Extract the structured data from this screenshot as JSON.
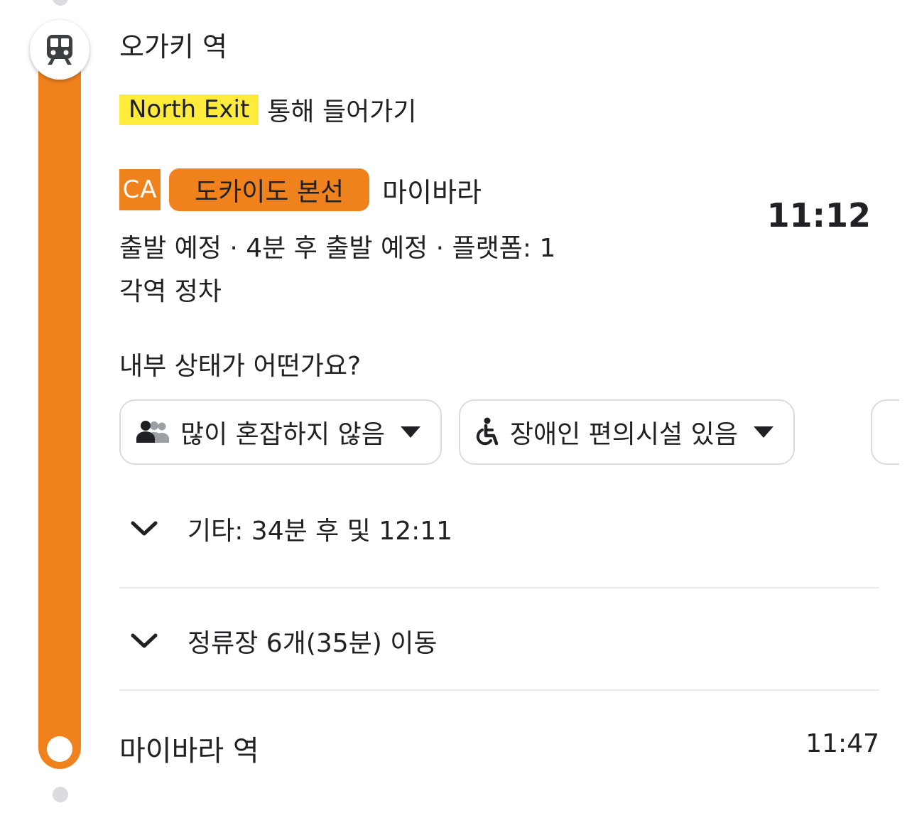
{
  "departure": {
    "station": "오가키 역",
    "exit_tag": "North Exit",
    "exit_suffix": "통해 들어가기"
  },
  "line": {
    "code": "CA",
    "name": "도카이도 본선",
    "destination": "마이바라",
    "color": "#f0821e",
    "departure_time": "11:12",
    "status": "출발 예정 · 4분 후 출발 예정 · 플랫폼: 1",
    "service": "각역 정차"
  },
  "feedback": {
    "question": "내부 상태가 어떤가요?",
    "chips": [
      {
        "icon": "crowd-icon",
        "label": "많이 혼잡하지 않음"
      },
      {
        "icon": "wheelchair-icon",
        "label": "장애인 편의시설 있음"
      }
    ]
  },
  "other_departures": "기타: 34분 후 및 12:11",
  "stops_summary": "정류장 6개(35분) 이동",
  "arrival": {
    "station": "마이바라 역",
    "time": "11:47"
  },
  "colors": {
    "accent": "#f0821e",
    "exit_highlight": "#ffeb3b",
    "divider": "#e8eaed",
    "timeline_dot": "#dadce0"
  }
}
